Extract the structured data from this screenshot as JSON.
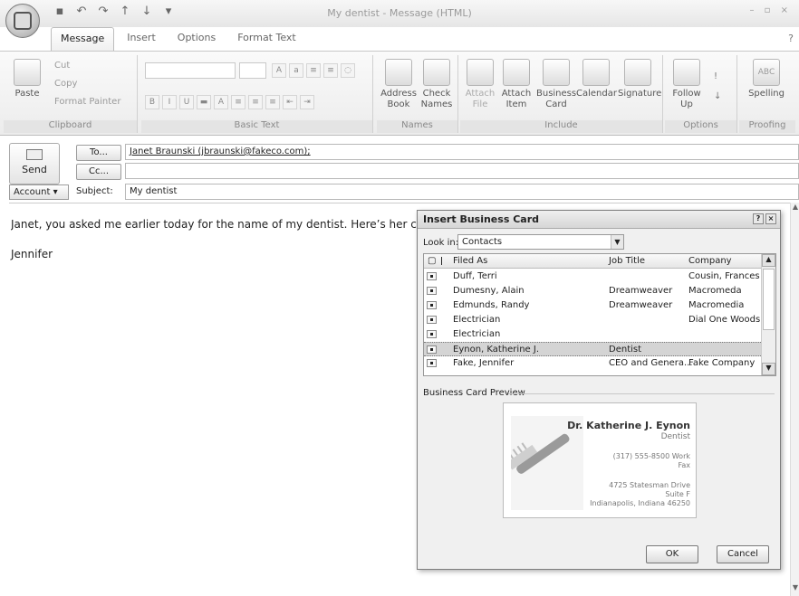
{
  "window": {
    "title": "My dentist - Message (HTML)"
  },
  "ribbon_tabs": [
    "Message",
    "Insert",
    "Options",
    "Format Text"
  ],
  "ribbon": {
    "clipboard": {
      "paste": "Paste",
      "cut": "Cut",
      "copy": "Copy",
      "format_painter": "Format Painter",
      "label": "Clipboard"
    },
    "basic_text": {
      "label": "Basic Text"
    },
    "names": {
      "address_book": "Address Book",
      "check_names": "Check Names",
      "label": "Names"
    },
    "include": {
      "attach_file": "Attach File",
      "attach_item": "Attach Item",
      "business_card": "Business Card",
      "calendar": "Calendar",
      "signature": "Signature",
      "label": "Include"
    },
    "options": {
      "follow_up": "Follow Up",
      "label": "Options"
    },
    "proofing": {
      "spelling": "Spelling",
      "abc": "ABC",
      "label": "Proofing"
    }
  },
  "compose": {
    "send": "Send",
    "to_button": "To...",
    "cc_button": "Cc...",
    "to_value": "Janet Braunski (jbraunski@fakeco.com);",
    "cc_value": "",
    "account_button": "Account",
    "subject_label": "Subject:",
    "subject_value": "My dentist",
    "body_line": "Janet, you asked me earlier today for the name of my dentist. Here’s her card. She’",
    "signature": "Jennifer"
  },
  "dialog": {
    "title": "Insert Business Card",
    "look_in_label": "Look in:",
    "look_in_value": "Contacts",
    "columns": {
      "filed_as": "Filed As",
      "job_title": "Job Title",
      "company": "Company"
    },
    "rows": [
      {
        "filed_as": "Duff, Terri",
        "job_title": "",
        "company": "Cousin, Frances ..."
      },
      {
        "filed_as": "Dumesny, Alain",
        "job_title": "Dreamweaver",
        "company": "Macromeda"
      },
      {
        "filed_as": "Edmunds, Randy",
        "job_title": "Dreamweaver",
        "company": "Macromedia"
      },
      {
        "filed_as": "Electrician",
        "job_title": "",
        "company": "Dial One Woods..."
      },
      {
        "filed_as": "Electrician",
        "job_title": "",
        "company": ""
      },
      {
        "filed_as": "Eynon, Katherine J.",
        "job_title": "Dentist",
        "company": ""
      },
      {
        "filed_as": "Fake, Jennifer",
        "job_title": "CEO and Genera...",
        "company": "Fake Company"
      }
    ],
    "selected_index": 5,
    "preview_label": "Business Card Preview",
    "card": {
      "name": "Dr. Katherine J. Eynon",
      "title": "Dentist",
      "phone": "(317) 555-8500 Work",
      "fax": "Fax",
      "street": "4725 Statesman Drive",
      "suite": "Suite F",
      "city": "Indianapolis, Indiana  46250"
    },
    "ok": "OK",
    "cancel": "Cancel"
  }
}
